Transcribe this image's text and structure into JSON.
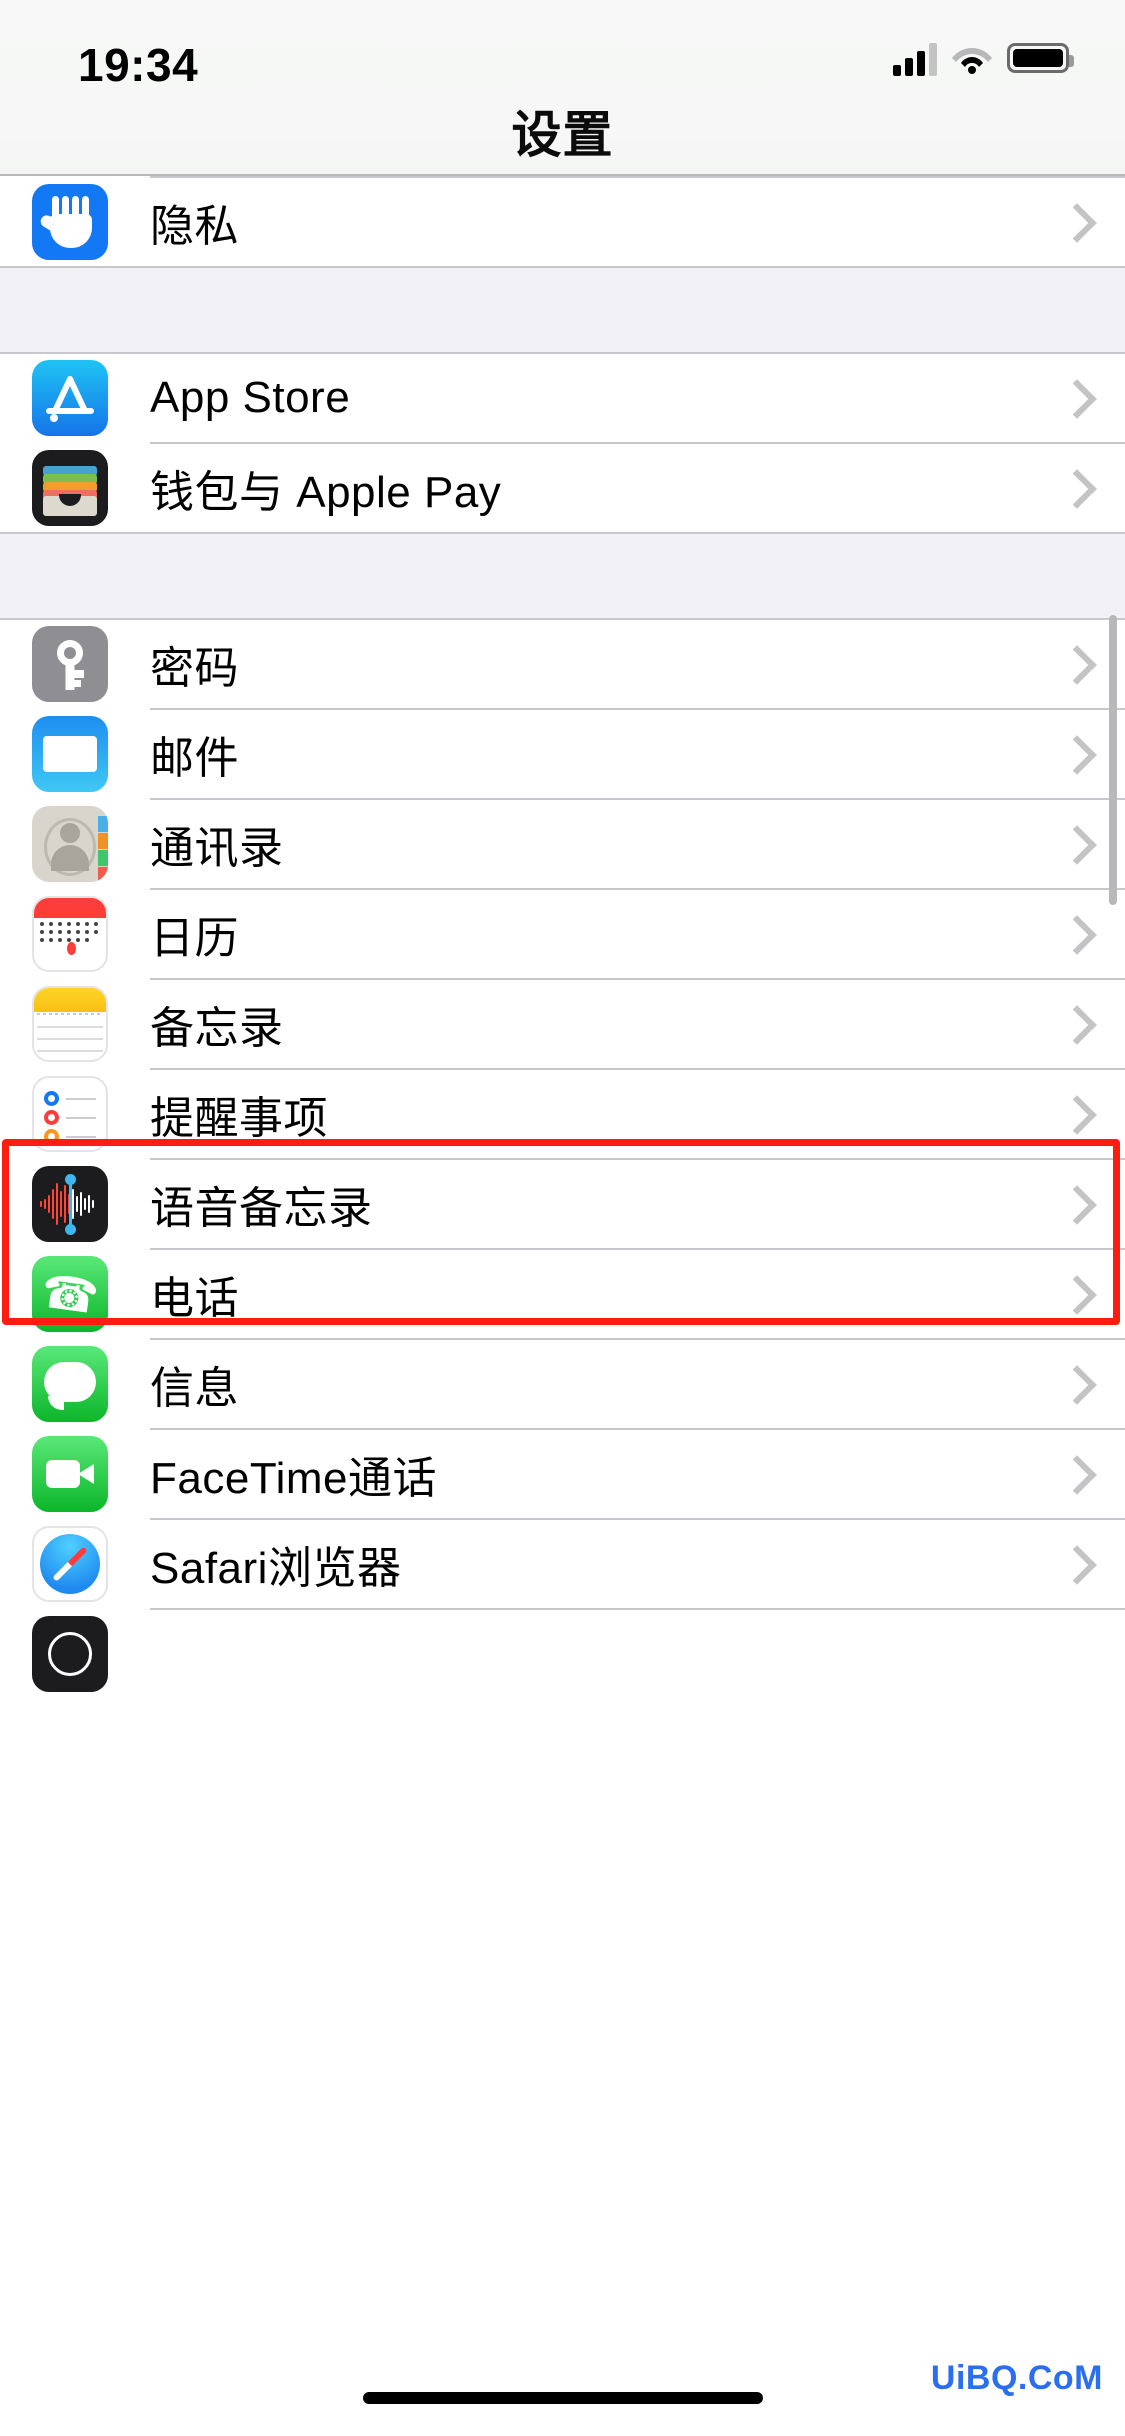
{
  "status_bar": {
    "time": "19:34",
    "cellular_icon": "cellular-signal-icon",
    "wifi_icon": "wifi-icon",
    "battery_icon": "battery-icon"
  },
  "nav": {
    "title": "设置"
  },
  "sections": [
    {
      "id": "privacy-section",
      "rows": [
        {
          "id": "privacy",
          "label": "隐私",
          "icon": "privacy-hand-icon",
          "chevron": true
        }
      ]
    },
    {
      "id": "store-section",
      "rows": [
        {
          "id": "app-store",
          "label": "App Store",
          "icon": "app-store-icon",
          "chevron": true
        },
        {
          "id": "wallet",
          "label": "钱包与 Apple Pay",
          "icon": "wallet-icon",
          "chevron": true
        }
      ]
    },
    {
      "id": "apps-section",
      "rows": [
        {
          "id": "passwords",
          "label": "密码",
          "icon": "key-icon",
          "chevron": true
        },
        {
          "id": "mail",
          "label": "邮件",
          "icon": "mail-icon",
          "chevron": true
        },
        {
          "id": "contacts",
          "label": "通讯录",
          "icon": "contacts-icon",
          "chevron": true,
          "highlighted": true
        },
        {
          "id": "calendar",
          "label": "日历",
          "icon": "calendar-icon",
          "chevron": true
        },
        {
          "id": "notes",
          "label": "备忘录",
          "icon": "notes-icon",
          "chevron": true
        },
        {
          "id": "reminders",
          "label": "提醒事项",
          "icon": "reminders-icon",
          "chevron": true
        },
        {
          "id": "voice-memos",
          "label": "语音备忘录",
          "icon": "voice-memos-icon",
          "chevron": true
        },
        {
          "id": "phone",
          "label": "电话",
          "icon": "phone-icon",
          "chevron": true
        },
        {
          "id": "messages",
          "label": "信息",
          "icon": "messages-icon",
          "chevron": true
        },
        {
          "id": "facetime",
          "label": "FaceTime通话",
          "icon": "facetime-icon",
          "chevron": true
        },
        {
          "id": "safari",
          "label": "Safari浏览器",
          "icon": "safari-icon",
          "chevron": true
        }
      ]
    }
  ],
  "annotation": {
    "target_row": "通讯录",
    "color": "#ff1d11"
  },
  "watermark": {
    "text": "UiBQ.CoM",
    "color": "#2a6ff0"
  },
  "colors": {
    "list_background": "#ffffff",
    "group_gap": "#f2f2f6",
    "separator": "#c8c7cc",
    "chevron": "#c4c4c6",
    "title_text": "#0b0b0b"
  }
}
